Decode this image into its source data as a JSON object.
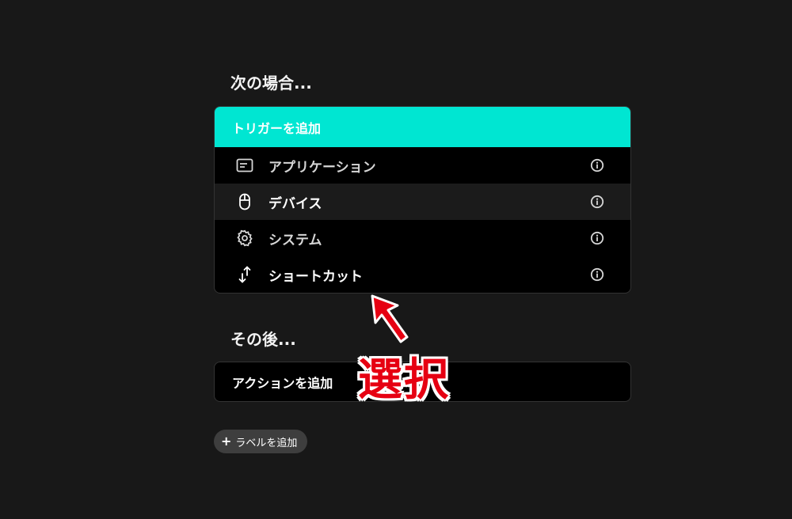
{
  "sections": {
    "when_heading": "次の場合...",
    "then_heading": "その後..."
  },
  "trigger": {
    "add_label": "トリガーを追加",
    "items": [
      {
        "label": "アプリケーション",
        "icon": "application-window-icon"
      },
      {
        "label": "デバイス",
        "icon": "mouse-icon"
      },
      {
        "label": "システム",
        "icon": "gear-icon"
      },
      {
        "label": "ショートカット",
        "icon": "up-down-arrow-icon"
      }
    ]
  },
  "action": {
    "add_label": "アクションを追加"
  },
  "label_chip": {
    "text": "ラベルを追加"
  },
  "annotation": {
    "text": "選択"
  },
  "colors": {
    "background": "#181818",
    "accent": "#00e6d2",
    "annotation": "#e60012"
  }
}
